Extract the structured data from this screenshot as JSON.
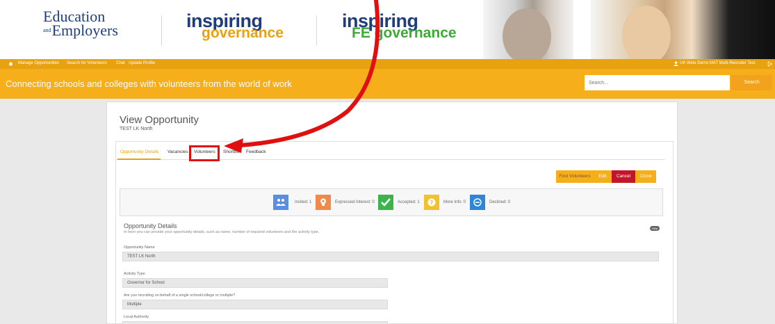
{
  "banner": {
    "logo1": {
      "line1": "Education",
      "and": "and",
      "line2": "Employers"
    },
    "logo2": {
      "part1": "inspiring",
      "part2": "governance"
    },
    "logo3": {
      "part1": "inspiring",
      "part2": "FE governance"
    }
  },
  "topnav": {
    "items": [
      "Manage Opportunities",
      "Search for Volunteers",
      "Chat",
      "Update Profile"
    ],
    "user": "UK Wide Demo MAT Multi-Recruiter Test"
  },
  "band": {
    "tagline": "Connecting schools and colleges with volunteers from the world of work",
    "search_placeholder": "Search...",
    "search_button": "Search"
  },
  "page": {
    "title": "View Opportunity",
    "subtitle": "TEST LK North",
    "tabs": [
      "Opportunity Details",
      "Vacancies",
      "Volunteers",
      "Shortlist",
      "Feedback"
    ],
    "actions": {
      "find": "Find Volunteers",
      "edit": "Edit",
      "cancel": "Cancel",
      "clone": "Clone"
    },
    "stats": [
      {
        "label": "Invited: 1",
        "color": "#5b8ee0",
        "icon": "people-icon"
      },
      {
        "label": "Expressed Interest: 0",
        "color": "#f08a4b",
        "icon": "lightbulb-icon"
      },
      {
        "label": "Accepted: 1",
        "color": "#3cb44b",
        "icon": "check-icon"
      },
      {
        "label": "More Info: 0",
        "color": "#f2c12e",
        "icon": "question-icon"
      },
      {
        "label": "Declined: 0",
        "color": "#2f86d6",
        "icon": "minus-circle-icon"
      }
    ],
    "section": {
      "title": "Opportunity Details",
      "desc": "In here you can provide your opportunity details, such as name, number of required volunteers and the activity type.",
      "help": "Help"
    },
    "fields": {
      "name_label": "Opportunity Name",
      "name_value": "TEST LK North",
      "activity_label": "Activity Type",
      "activity_value": "Governor for School",
      "recruit_label": "Are you recruiting on behalf of a single school/college or multiple?",
      "recruit_value": "Multiple",
      "la_label": "Local Authority"
    }
  },
  "colors": {
    "accent": "#f6ae1b",
    "cancel": "#c4162b",
    "annotation": "#e01010"
  }
}
